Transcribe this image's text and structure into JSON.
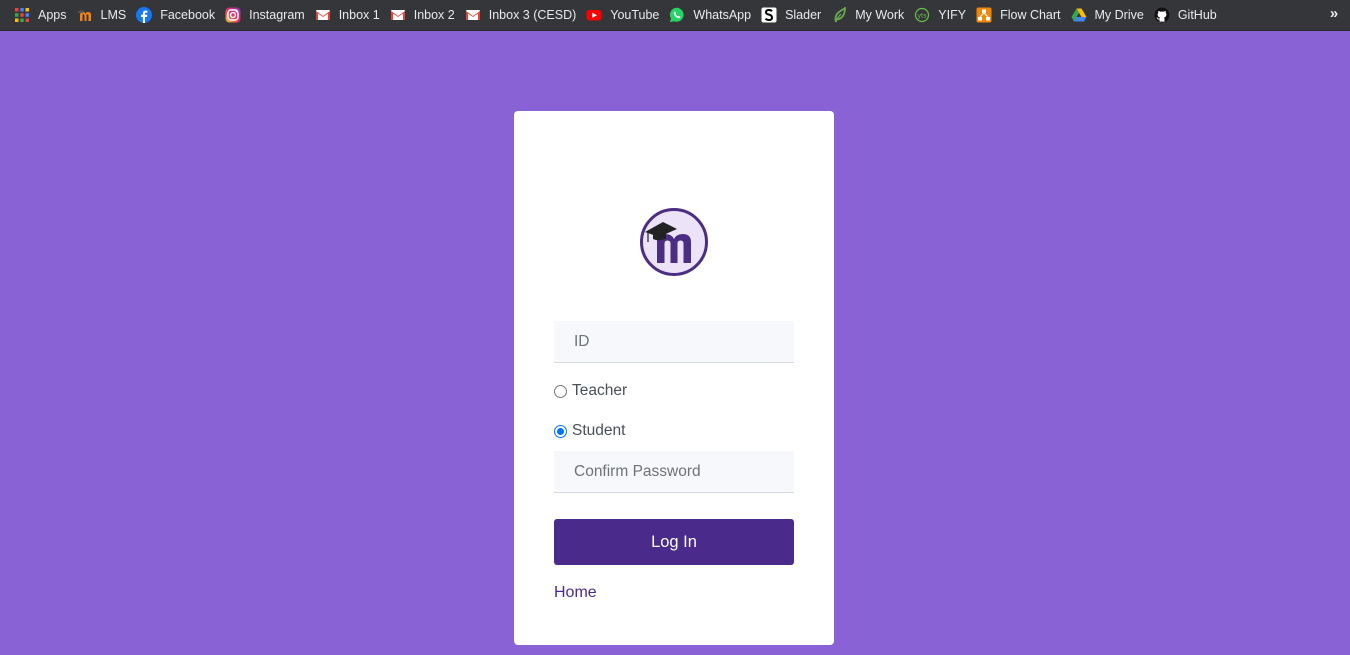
{
  "bookmarks_bar": {
    "items": [
      {
        "label": "Apps",
        "icon": "apps-grid-icon"
      },
      {
        "label": "LMS",
        "icon": "moodle-icon"
      },
      {
        "label": "Facebook",
        "icon": "facebook-icon"
      },
      {
        "label": "Instagram",
        "icon": "instagram-icon"
      },
      {
        "label": "Inbox 1",
        "icon": "gmail-icon"
      },
      {
        "label": "Inbox 2",
        "icon": "gmail-icon"
      },
      {
        "label": "Inbox 3 (CESD)",
        "icon": "gmail-icon"
      },
      {
        "label": "YouTube",
        "icon": "youtube-icon"
      },
      {
        "label": "WhatsApp",
        "icon": "whatsapp-icon"
      },
      {
        "label": "Slader",
        "icon": "slader-icon"
      },
      {
        "label": "My Work",
        "icon": "leaf-icon"
      },
      {
        "label": "YIFY",
        "icon": "yify-icon"
      },
      {
        "label": "Flow Chart",
        "icon": "flowchart-icon"
      },
      {
        "label": "My Drive",
        "icon": "google-drive-icon"
      },
      {
        "label": "GitHub",
        "icon": "github-icon"
      }
    ],
    "overflow": "»"
  },
  "login": {
    "id_placeholder": "ID",
    "role_options": [
      {
        "label": "Teacher",
        "checked": false
      },
      {
        "label": "Student",
        "checked": true
      }
    ],
    "password_placeholder": "Confirm Password",
    "submit_label": "Log In",
    "home_link": "Home"
  },
  "colors": {
    "page_background": "#8963d6",
    "accent": "#4a2a8a",
    "radio_checked": "#0075ff",
    "bookmarks_bar": "#35363a"
  }
}
